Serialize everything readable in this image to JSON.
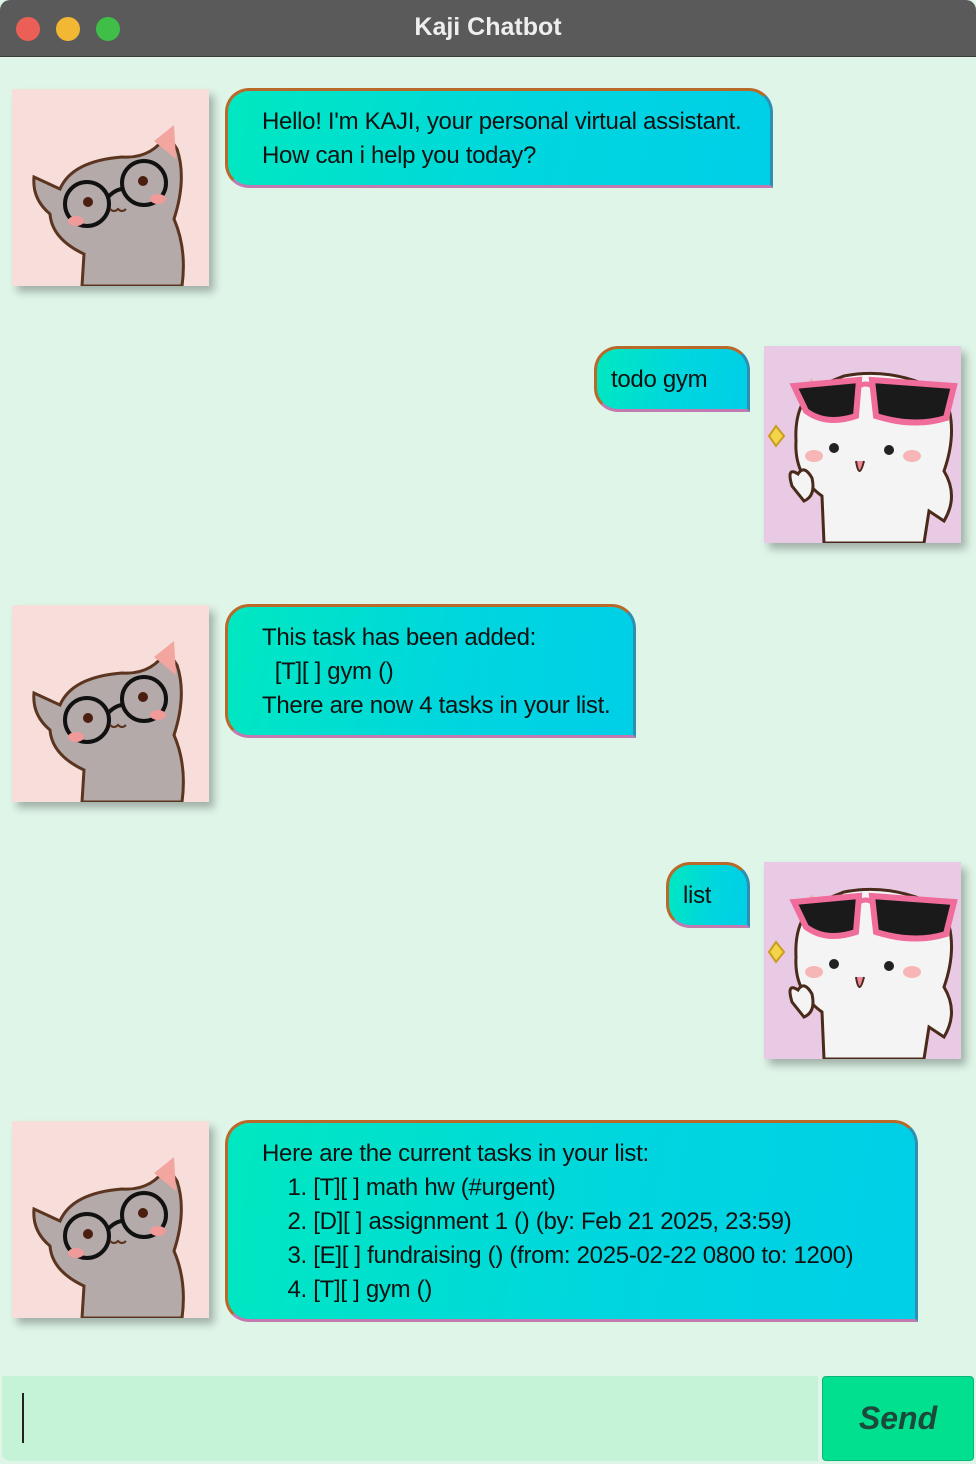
{
  "window": {
    "title": "Kaji Chatbot"
  },
  "messages": [
    {
      "sender": "bot",
      "text": "Hello! I'm KAJI, your personal virtual assistant.\nHow can i help you today?"
    },
    {
      "sender": "user",
      "text": "todo gym"
    },
    {
      "sender": "bot",
      "text": "This task has been added:\n  [T][ ] gym ()\nThere are now 4 tasks in your list."
    },
    {
      "sender": "user",
      "text": "list"
    },
    {
      "sender": "bot",
      "text": "Here are the current tasks in your list:\n    1. [T][ ] math hw (#urgent)\n    2. [D][ ] assignment 1 () (by: Feb 21 2025, 23:59)\n    3. [E][ ] fundraising () (from: 2025-02-22 0800 to: 1200)\n    4. [T][ ] gym ()"
    }
  ],
  "input": {
    "value": "",
    "placeholder": ""
  },
  "send_button": {
    "label": "Send"
  },
  "colors": {
    "background": "#dff5e8",
    "bubble_start": "#00e8c0",
    "bubble_end": "#00cfe8",
    "send_button": "#00e08e",
    "input_bg": "#c5f3d7"
  }
}
